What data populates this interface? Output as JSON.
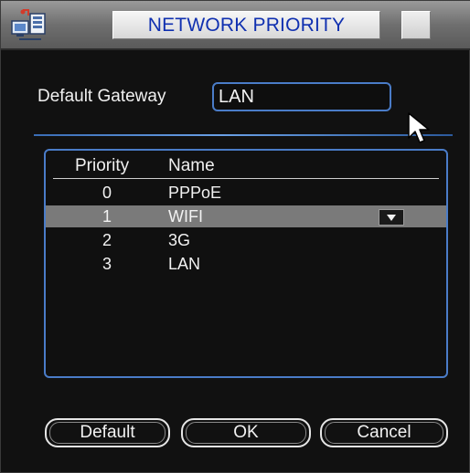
{
  "window": {
    "title": "NETWORK PRIORITY",
    "icon": "network-settings-icon"
  },
  "gateway": {
    "label": "Default Gateway",
    "value": "LAN"
  },
  "priority_table": {
    "columns": [
      "Priority",
      "Name"
    ],
    "rows": [
      {
        "priority": "0",
        "name": "PPPoE",
        "selected": false
      },
      {
        "priority": "1",
        "name": "WIFI",
        "selected": true
      },
      {
        "priority": "2",
        "name": "3G",
        "selected": false
      },
      {
        "priority": "3",
        "name": "LAN",
        "selected": false
      }
    ],
    "selected_row_control": "dropdown-arrow-icon"
  },
  "buttons": {
    "default": "Default",
    "ok": "OK",
    "cancel": "Cancel"
  },
  "colors": {
    "title_text": "#1030b0",
    "accent_border": "#4a7cc8",
    "selected_row": "#7a7a7a",
    "background": "#111111"
  },
  "cursor": "mouse-pointer-icon"
}
